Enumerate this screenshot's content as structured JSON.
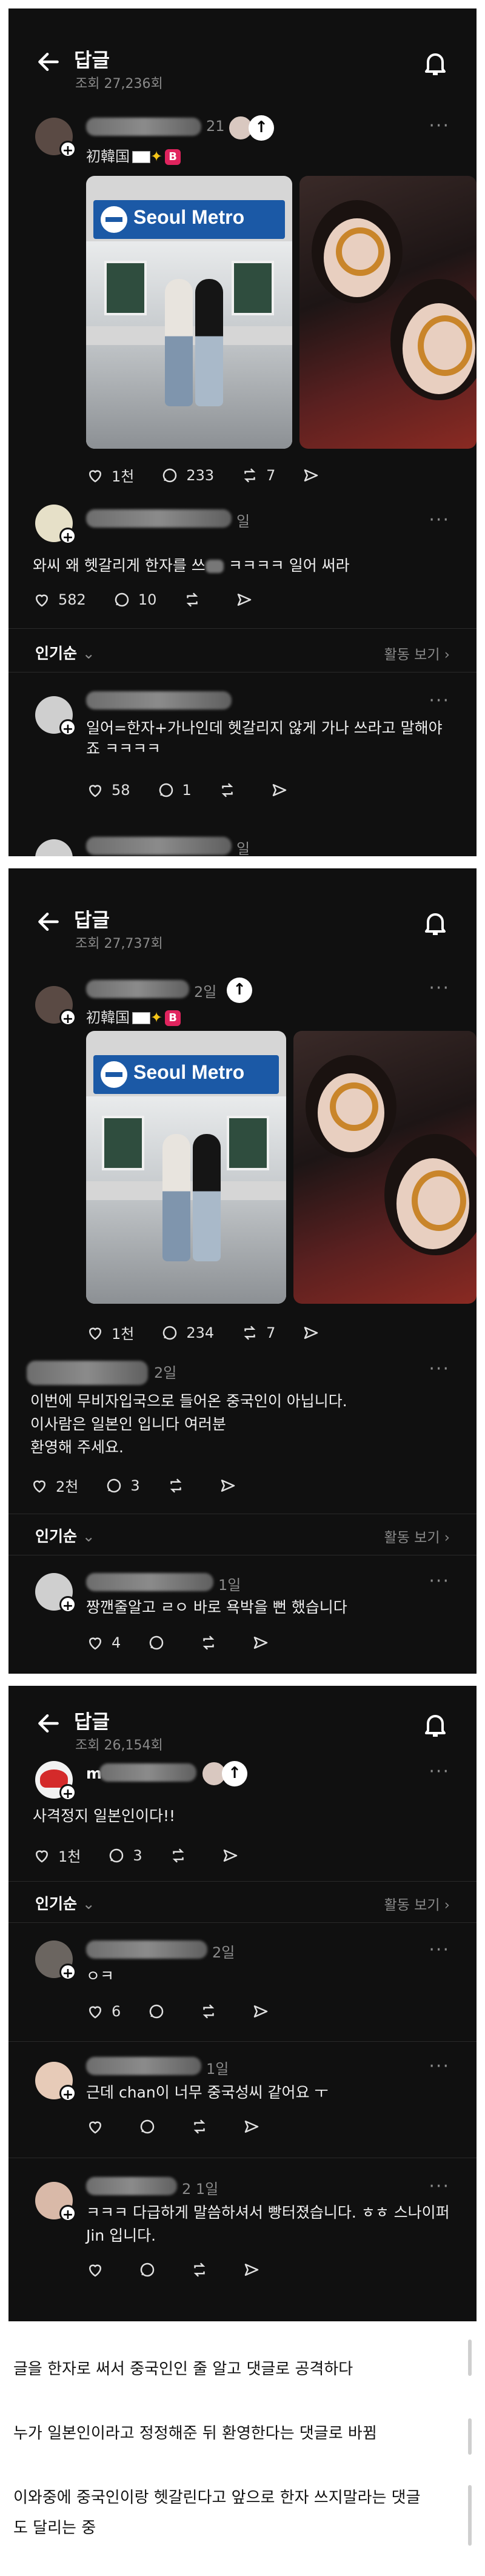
{
  "panels": [
    {
      "header": {
        "title": "답글",
        "views": "조회 27,236회"
      },
      "op": {
        "name_suffix": "21",
        "flair": "初韓国",
        "badge": "B",
        "actions": {
          "likes": "1천",
          "comments": "233",
          "reposts": "7"
        }
      },
      "reply": {
        "time": "일",
        "text": "와씨 왜 헷갈리게 한자를 쓰",
        "text_tail": "ㅋㅋㅋㅋ 일어 써라",
        "actions": {
          "likes": "582",
          "comments": "10"
        }
      },
      "sort": {
        "label": "인기순",
        "view_activity": "활동 보기"
      },
      "comment": {
        "text": "일어=한자+가나인데 헷갈리지 않게 가나 쓰라고 말해야죠 ㅋㅋㅋㅋ",
        "actions": {
          "likes": "58",
          "comments": "1"
        }
      },
      "trailing_time": "일"
    },
    {
      "header": {
        "title": "답글",
        "views": "조회 27,737회"
      },
      "op": {
        "name_suffix": "2일",
        "flair": "初韓国",
        "badge": "B",
        "actions": {
          "likes": "1천",
          "comments": "234",
          "reposts": "7"
        }
      },
      "reply": {
        "time": "2일",
        "text_lines": [
          "이번에 무비자입국으로 들어온 중국인이 아닙니다.",
          "이사람은 일본인 입니다 여러분",
          "환영해 주세요."
        ],
        "actions": {
          "likes": "2천",
          "comments": "3"
        }
      },
      "sort": {
        "label": "인기순",
        "view_activity": "활동 보기"
      },
      "comment": {
        "time": "1일",
        "text": "짱깬줄알고 ㄹㅇ 바로 욕박을 뻔 했습니다",
        "actions": {
          "likes": "4"
        }
      }
    },
    {
      "header": {
        "title": "답글",
        "views": "조회 26,154회"
      },
      "op": {
        "name_initial": "m",
        "text": "사격정지 일본인이다!!",
        "actions": {
          "likes": "1천",
          "comments": "3"
        }
      },
      "sort": {
        "label": "인기순",
        "view_activity": "활동 보기"
      },
      "comments": [
        {
          "time": "2일",
          "text": "ㅇㅋ",
          "likes": "6"
        },
        {
          "time": "1일",
          "text": "근데 chan이 너무 중국성씨 같어요 ㅜ"
        },
        {
          "time": "2 1일",
          "text_lines": [
            "ㅋㅋㅋ 다급하게 말씀하셔서 빵터졌습니다. ㅎㅎ 스나이퍼",
            "Jin 입니다."
          ]
        }
      ]
    }
  ],
  "photo_sign": "Seoul Metro",
  "captions": [
    "글을 한자로 써서 중국인인 줄 알고 댓글로 공격하다",
    "누가 일본인이라고 정정해준 뒤 환영한다는 댓글로 바뀜",
    "이와중에 중국인이랑 헷갈린다고 앞으로 한자 쓰지말라는 댓글",
    "도 달리는 중"
  ]
}
